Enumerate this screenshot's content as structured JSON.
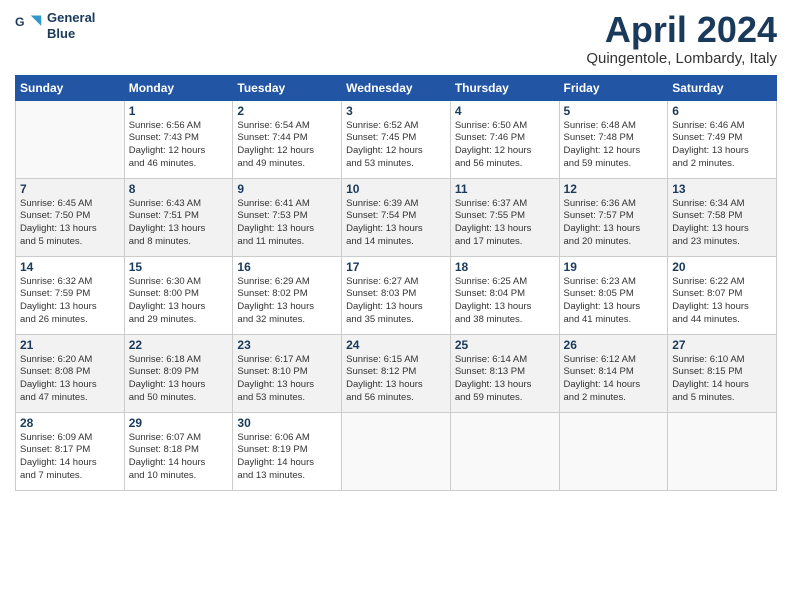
{
  "header": {
    "logo_line1": "General",
    "logo_line2": "Blue",
    "month": "April 2024",
    "location": "Quingentole, Lombardy, Italy"
  },
  "days_of_week": [
    "Sunday",
    "Monday",
    "Tuesday",
    "Wednesday",
    "Thursday",
    "Friday",
    "Saturday"
  ],
  "weeks": [
    [
      {
        "num": "",
        "info": ""
      },
      {
        "num": "1",
        "info": "Sunrise: 6:56 AM\nSunset: 7:43 PM\nDaylight: 12 hours\nand 46 minutes."
      },
      {
        "num": "2",
        "info": "Sunrise: 6:54 AM\nSunset: 7:44 PM\nDaylight: 12 hours\nand 49 minutes."
      },
      {
        "num": "3",
        "info": "Sunrise: 6:52 AM\nSunset: 7:45 PM\nDaylight: 12 hours\nand 53 minutes."
      },
      {
        "num": "4",
        "info": "Sunrise: 6:50 AM\nSunset: 7:46 PM\nDaylight: 12 hours\nand 56 minutes."
      },
      {
        "num": "5",
        "info": "Sunrise: 6:48 AM\nSunset: 7:48 PM\nDaylight: 12 hours\nand 59 minutes."
      },
      {
        "num": "6",
        "info": "Sunrise: 6:46 AM\nSunset: 7:49 PM\nDaylight: 13 hours\nand 2 minutes."
      }
    ],
    [
      {
        "num": "7",
        "info": "Sunrise: 6:45 AM\nSunset: 7:50 PM\nDaylight: 13 hours\nand 5 minutes."
      },
      {
        "num": "8",
        "info": "Sunrise: 6:43 AM\nSunset: 7:51 PM\nDaylight: 13 hours\nand 8 minutes."
      },
      {
        "num": "9",
        "info": "Sunrise: 6:41 AM\nSunset: 7:53 PM\nDaylight: 13 hours\nand 11 minutes."
      },
      {
        "num": "10",
        "info": "Sunrise: 6:39 AM\nSunset: 7:54 PM\nDaylight: 13 hours\nand 14 minutes."
      },
      {
        "num": "11",
        "info": "Sunrise: 6:37 AM\nSunset: 7:55 PM\nDaylight: 13 hours\nand 17 minutes."
      },
      {
        "num": "12",
        "info": "Sunrise: 6:36 AM\nSunset: 7:57 PM\nDaylight: 13 hours\nand 20 minutes."
      },
      {
        "num": "13",
        "info": "Sunrise: 6:34 AM\nSunset: 7:58 PM\nDaylight: 13 hours\nand 23 minutes."
      }
    ],
    [
      {
        "num": "14",
        "info": "Sunrise: 6:32 AM\nSunset: 7:59 PM\nDaylight: 13 hours\nand 26 minutes."
      },
      {
        "num": "15",
        "info": "Sunrise: 6:30 AM\nSunset: 8:00 PM\nDaylight: 13 hours\nand 29 minutes."
      },
      {
        "num": "16",
        "info": "Sunrise: 6:29 AM\nSunset: 8:02 PM\nDaylight: 13 hours\nand 32 minutes."
      },
      {
        "num": "17",
        "info": "Sunrise: 6:27 AM\nSunset: 8:03 PM\nDaylight: 13 hours\nand 35 minutes."
      },
      {
        "num": "18",
        "info": "Sunrise: 6:25 AM\nSunset: 8:04 PM\nDaylight: 13 hours\nand 38 minutes."
      },
      {
        "num": "19",
        "info": "Sunrise: 6:23 AM\nSunset: 8:05 PM\nDaylight: 13 hours\nand 41 minutes."
      },
      {
        "num": "20",
        "info": "Sunrise: 6:22 AM\nSunset: 8:07 PM\nDaylight: 13 hours\nand 44 minutes."
      }
    ],
    [
      {
        "num": "21",
        "info": "Sunrise: 6:20 AM\nSunset: 8:08 PM\nDaylight: 13 hours\nand 47 minutes."
      },
      {
        "num": "22",
        "info": "Sunrise: 6:18 AM\nSunset: 8:09 PM\nDaylight: 13 hours\nand 50 minutes."
      },
      {
        "num": "23",
        "info": "Sunrise: 6:17 AM\nSunset: 8:10 PM\nDaylight: 13 hours\nand 53 minutes."
      },
      {
        "num": "24",
        "info": "Sunrise: 6:15 AM\nSunset: 8:12 PM\nDaylight: 13 hours\nand 56 minutes."
      },
      {
        "num": "25",
        "info": "Sunrise: 6:14 AM\nSunset: 8:13 PM\nDaylight: 13 hours\nand 59 minutes."
      },
      {
        "num": "26",
        "info": "Sunrise: 6:12 AM\nSunset: 8:14 PM\nDaylight: 14 hours\nand 2 minutes."
      },
      {
        "num": "27",
        "info": "Sunrise: 6:10 AM\nSunset: 8:15 PM\nDaylight: 14 hours\nand 5 minutes."
      }
    ],
    [
      {
        "num": "28",
        "info": "Sunrise: 6:09 AM\nSunset: 8:17 PM\nDaylight: 14 hours\nand 7 minutes."
      },
      {
        "num": "29",
        "info": "Sunrise: 6:07 AM\nSunset: 8:18 PM\nDaylight: 14 hours\nand 10 minutes."
      },
      {
        "num": "30",
        "info": "Sunrise: 6:06 AM\nSunset: 8:19 PM\nDaylight: 14 hours\nand 13 minutes."
      },
      {
        "num": "",
        "info": ""
      },
      {
        "num": "",
        "info": ""
      },
      {
        "num": "",
        "info": ""
      },
      {
        "num": "",
        "info": ""
      }
    ]
  ]
}
